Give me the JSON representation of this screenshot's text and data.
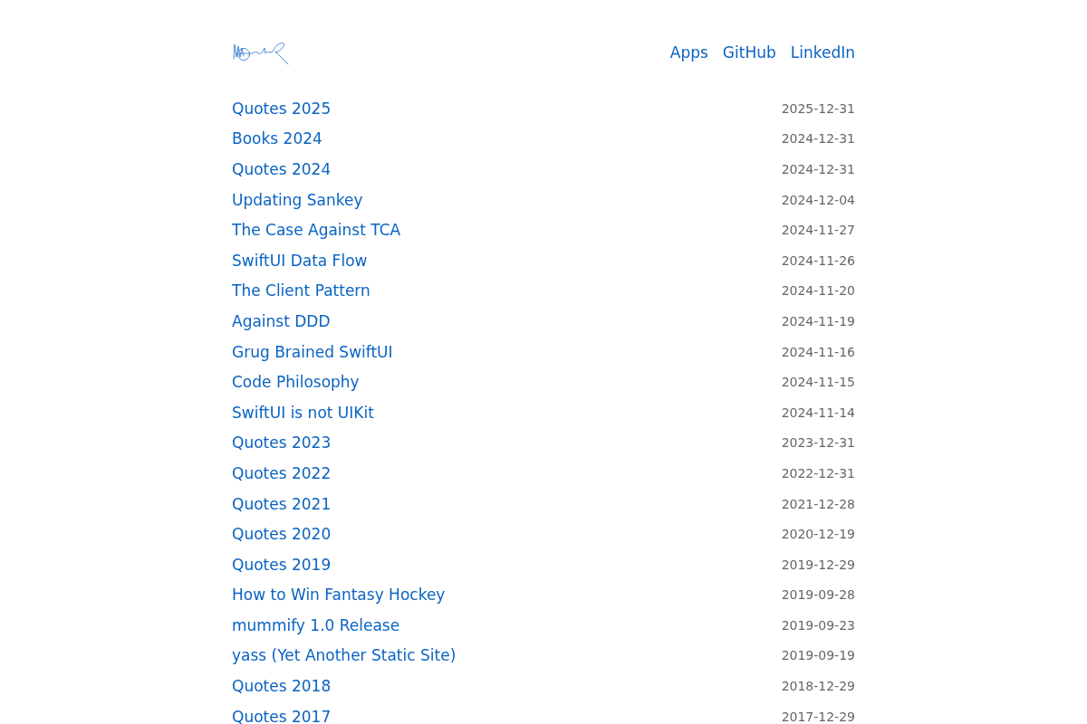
{
  "header": {
    "nav_links": [
      "Apps",
      "GitHub",
      "LinkedIn"
    ]
  },
  "posts": [
    {
      "title": "Quotes 2025",
      "date": "2025-12-31"
    },
    {
      "title": "Books 2024",
      "date": "2024-12-31"
    },
    {
      "title": "Quotes 2024",
      "date": "2024-12-31"
    },
    {
      "title": "Updating Sankey",
      "date": "2024-12-04"
    },
    {
      "title": "The Case Against TCA",
      "date": "2024-11-27"
    },
    {
      "title": "SwiftUI Data Flow",
      "date": "2024-11-26"
    },
    {
      "title": "The Client Pattern",
      "date": "2024-11-20"
    },
    {
      "title": "Against DDD",
      "date": "2024-11-19"
    },
    {
      "title": "Grug Brained SwiftUI",
      "date": "2024-11-16"
    },
    {
      "title": "Code Philosophy",
      "date": "2024-11-15"
    },
    {
      "title": "SwiftUI is not UIKit",
      "date": "2024-11-14"
    },
    {
      "title": "Quotes 2023",
      "date": "2023-12-31"
    },
    {
      "title": "Quotes 2022",
      "date": "2022-12-31"
    },
    {
      "title": "Quotes 2021",
      "date": "2021-12-28"
    },
    {
      "title": "Quotes 2020",
      "date": "2020-12-19"
    },
    {
      "title": "Quotes 2019",
      "date": "2019-12-29"
    },
    {
      "title": "How to Win Fantasy Hockey",
      "date": "2019-09-28"
    },
    {
      "title": "mummify 1.0 Release",
      "date": "2019-09-23"
    },
    {
      "title": "yass (Yet Another Static Site)",
      "date": "2019-09-19"
    },
    {
      "title": "Quotes 2018",
      "date": "2018-12-29"
    },
    {
      "title": "Quotes 2017",
      "date": "2017-12-29"
    }
  ]
}
